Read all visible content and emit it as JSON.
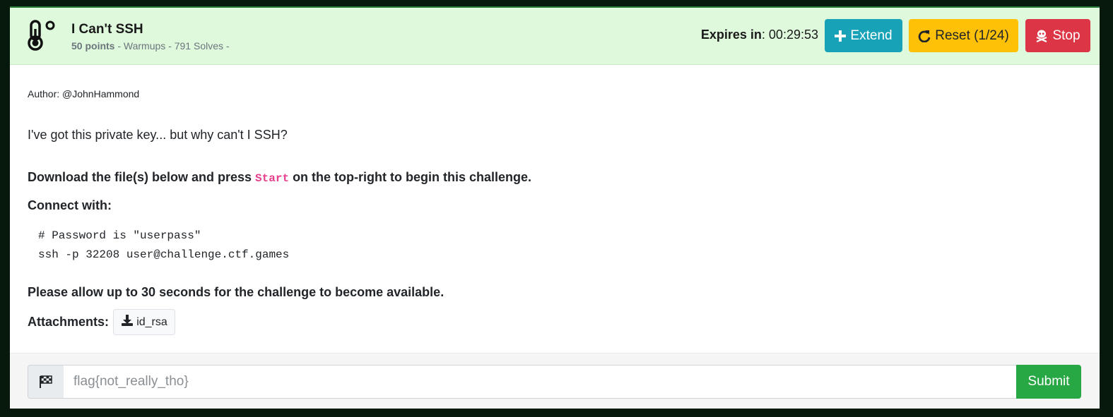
{
  "challenge": {
    "title": "I Can't SSH",
    "points": "50 points",
    "meta": " - Warmups - 791 Solves -"
  },
  "timer": {
    "label": "Expires in",
    "value": ": 00:29:53"
  },
  "buttons": {
    "extend": "Extend",
    "reset": "Reset (1/24)",
    "stop": "Stop"
  },
  "content": {
    "author": "Author: @JohnHammond",
    "description": "I've got this private key... but why can't I SSH?",
    "download_prefix": "Download the file(s) below and press ",
    "download_code": "Start",
    "download_suffix": " on the top-right to begin this challenge.",
    "connect_label": "Connect with:",
    "code_lines": "# Password is \"userpass\"\nssh -p 32208 user@challenge.ctf.games",
    "availability": "Please allow up to 30 seconds for the challenge to become available.",
    "attachments_label": "Attachments:",
    "attachment_file": "id_rsa"
  },
  "flag_form": {
    "placeholder": "flag{not_really_tho}",
    "submit_label": "Submit"
  },
  "colors": {
    "header_bg": "#dff9dc",
    "extend": "#17a2b8",
    "reset": "#ffc107",
    "stop": "#dc3545",
    "submit": "#28a745",
    "code_accent": "#e83e8c"
  },
  "icons": {
    "category": "thermometer-icon",
    "extend": "plus-icon",
    "reset": "redo-icon",
    "stop": "skull-crossbones-icon",
    "attachment": "download-icon",
    "flag": "flag-checkered-icon"
  }
}
